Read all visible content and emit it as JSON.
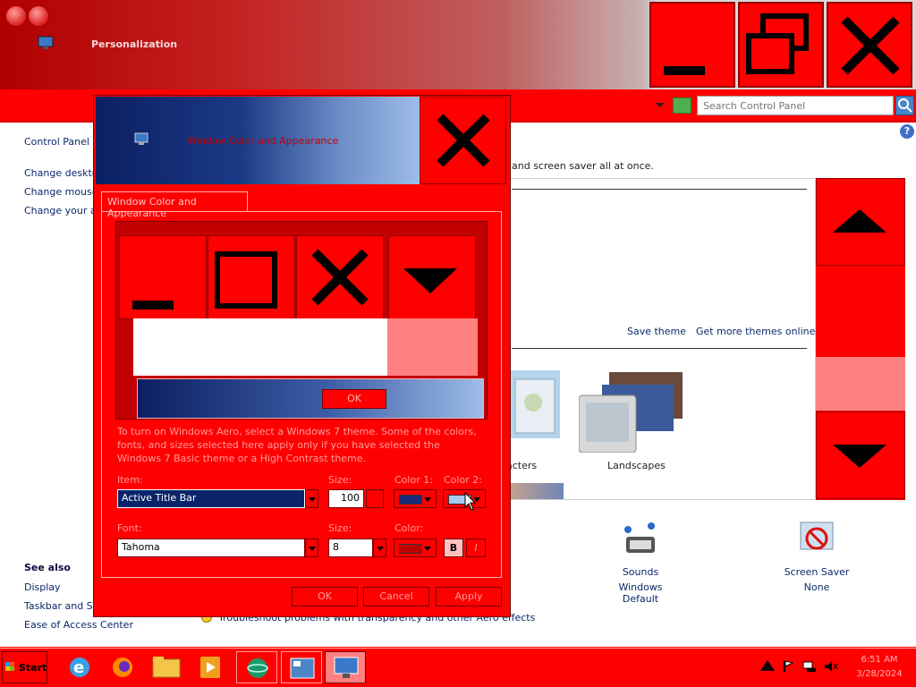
{
  "window": {
    "title": "Personalization",
    "caption_buttons": [
      "minimize",
      "maximize",
      "close"
    ]
  },
  "address_bar": {
    "search_placeholder": "Search Control Panel"
  },
  "sidebar": {
    "items": [
      {
        "label": "Control Panel Ho"
      },
      {
        "label": "Change desktop"
      },
      {
        "label": "Change mouse p"
      },
      {
        "label": "Change your ac"
      }
    ],
    "see_also": {
      "heading": "See also",
      "items": [
        {
          "label": "Display"
        },
        {
          "label": "Taskbar and Sta"
        },
        {
          "label": "Ease of Access Center"
        }
      ]
    }
  },
  "main": {
    "intro_tail": "and screen saver all at once.",
    "theme_links": {
      "save": "Save theme",
      "more": "Get more themes online"
    },
    "themes": [
      {
        "label": "acters"
      },
      {
        "label": "Landscapes"
      }
    ],
    "tiles": [
      {
        "label": "Sounds",
        "sub": "Windows Default"
      },
      {
        "label": "Screen Saver",
        "sub": "None"
      }
    ],
    "troubleshoot": "Troubleshoot problems with transparency and other Aero effects"
  },
  "dialog": {
    "title": "Window Color and Appearance",
    "tab": "Window Color and Appearance",
    "preview_ok": "OK",
    "info": "To turn on Windows Aero, select a Windows 7 theme.  Some of the colors, fonts, and sizes selected here apply only if you have selected the Windows 7 Basic theme or a High Contrast theme.",
    "item_label": "Item:",
    "item_value": "Active Title Bar",
    "item_size_label": "Size:",
    "item_size_value": "100",
    "color1_label": "Color 1:",
    "color2_label": "Color 2:",
    "font_label": "Font:",
    "font_value": "Tahoma",
    "font_size_label": "Size:",
    "font_size_value": "8",
    "font_color_label": "Color:",
    "bold_label": "B",
    "italic_label": "I",
    "buttons": {
      "ok": "OK",
      "cancel": "Cancel",
      "apply": "Apply"
    }
  },
  "colors": {
    "color1": "#1a2a7a",
    "color2": "#a6caf0",
    "font_color": "#c00000"
  },
  "taskbar": {
    "start_label": "Start",
    "apps": [
      "internet-explorer",
      "firefox",
      "file-explorer",
      "media-player",
      "network-app",
      "control-panel",
      "personalization"
    ],
    "clock_time": "6:51 AM",
    "clock_date": "3/28/2024"
  }
}
